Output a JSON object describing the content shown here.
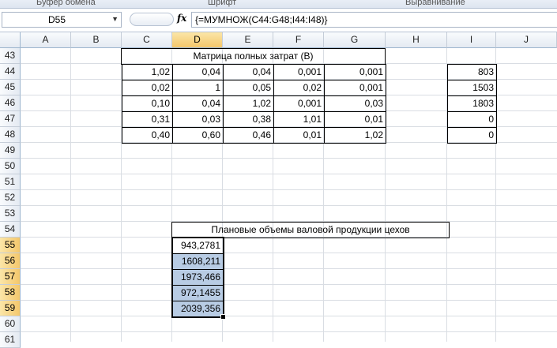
{
  "ribbon": {
    "groups": [
      "Буфер обмена",
      "Шрифт",
      "Выравнивание"
    ]
  },
  "formula_bar": {
    "name_box": "D55",
    "fx": "fx",
    "formula": "{=МУМНОЖ(C44:G48;I44:I48)}"
  },
  "columns": [
    "A",
    "B",
    "C",
    "D",
    "E",
    "F",
    "G",
    "H",
    "I",
    "J"
  ],
  "rows": [
    "43",
    "44",
    "45",
    "46",
    "47",
    "48",
    "49",
    "50",
    "51",
    "52",
    "53",
    "54",
    "55",
    "56",
    "57",
    "58",
    "59",
    "60",
    "61"
  ],
  "matrix": {
    "title": "Матрица полных затрат (B)",
    "values": [
      [
        "1,02",
        "0,04",
        "0,04",
        "0,001",
        "0,001"
      ],
      [
        "0,02",
        "1",
        "0,05",
        "0,02",
        "0,001"
      ],
      [
        "0,10",
        "0,04",
        "1,02",
        "0,001",
        "0,03"
      ],
      [
        "0,31",
        "0,03",
        "0,38",
        "1,01",
        "0,01"
      ],
      [
        "0,40",
        "0,60",
        "0,46",
        "0,01",
        "1,02"
      ]
    ]
  },
  "vector_i": [
    "803",
    "1503",
    "1803",
    "0",
    "0"
  ],
  "result": {
    "title": "Плановые объемы валовой продукции цехов",
    "values": [
      "943,2781",
      "1608,211",
      "1973,466",
      "972,1455",
      "2039,356"
    ]
  }
}
